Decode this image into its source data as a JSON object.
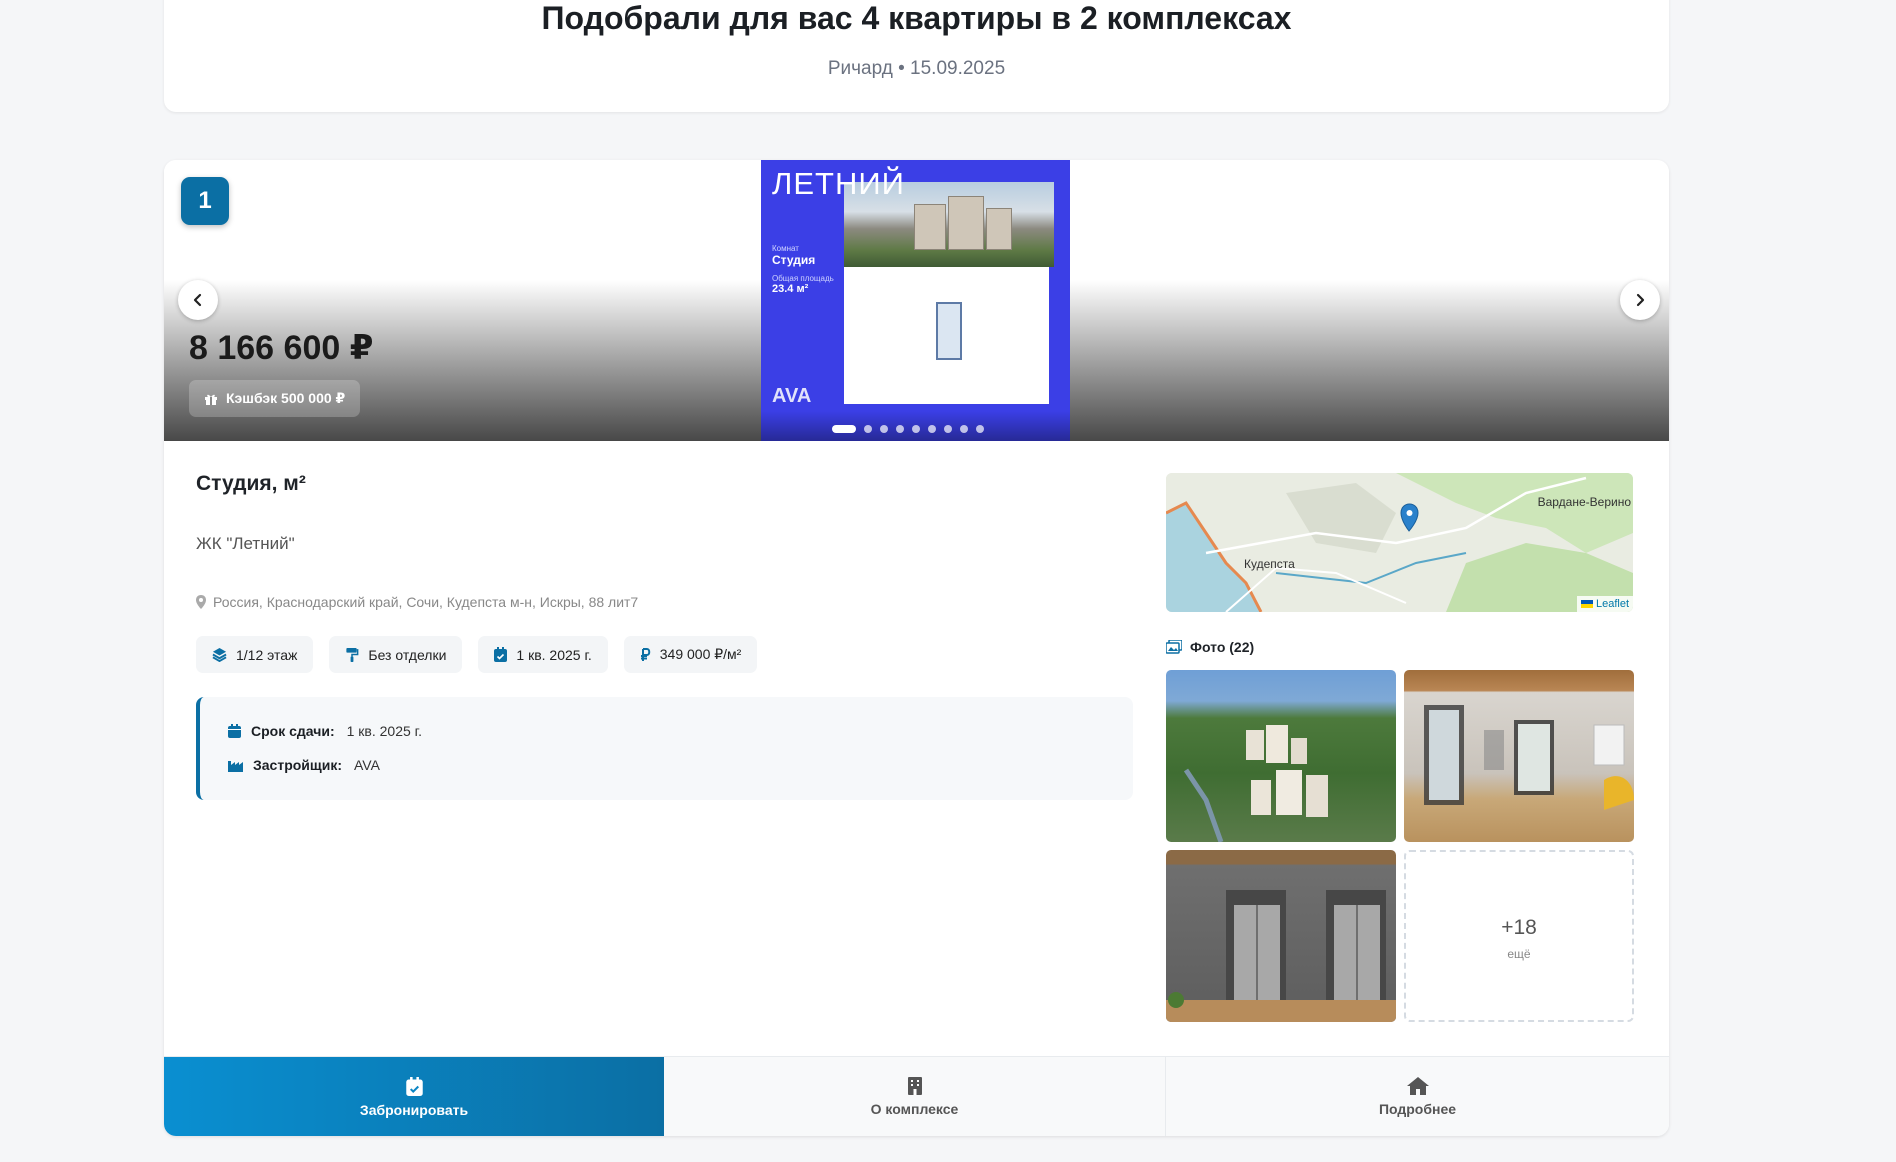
{
  "header": {
    "title": "Подобрали для вас 4 квартиры в 2 комплексах",
    "meta": "Ричард • 15.09.2025"
  },
  "card": {
    "index": "1",
    "price": "8 166 600 ₽",
    "cashback": "Кэшбэк 500 000 ₽",
    "poster": {
      "title": "ЛЕТНИЙ",
      "rooms_label": "Комнат",
      "rooms_value": "Студия",
      "area_label": "Общая площадь",
      "area_value": "23.4 м²",
      "brand": "AVA"
    },
    "carousel": {
      "dot_count": 9,
      "active_index": 0
    },
    "apartment_title": "Студия, м²",
    "complex_name": "ЖК \"Летний\"",
    "address": "Россия, Краснодарский край, Сочи, Кудепста м-н, Искры, 88 лит7",
    "chips": [
      {
        "icon": "layers-icon",
        "label": "1/12 этаж"
      },
      {
        "icon": "paint-roller-icon",
        "label": "Без отделки"
      },
      {
        "icon": "calendar-check-icon",
        "label": "1 кв. 2025 г."
      },
      {
        "icon": "ruble-icon",
        "label": "349 000 ₽/м²"
      }
    ],
    "info": {
      "deadline_label": "Срок сдачи:",
      "deadline_value": "1 кв. 2025 г.",
      "developer_label": "Застройщик:",
      "developer_value": "AVA"
    },
    "map": {
      "label_town": "Кудепста",
      "label_village": "Вардане-Верино",
      "credit": "Leaflet"
    },
    "photos": {
      "label": "Фото (22)",
      "more_count": "+18",
      "more_sub": "ещё"
    },
    "actions": {
      "book": "Забронировать",
      "about": "О комплексе",
      "details": "Подробнее"
    }
  },
  "colors": {
    "accent": "#0b6fa4",
    "accent_light": "#0a8fd1",
    "poster_blue": "#3b3fe6"
  }
}
